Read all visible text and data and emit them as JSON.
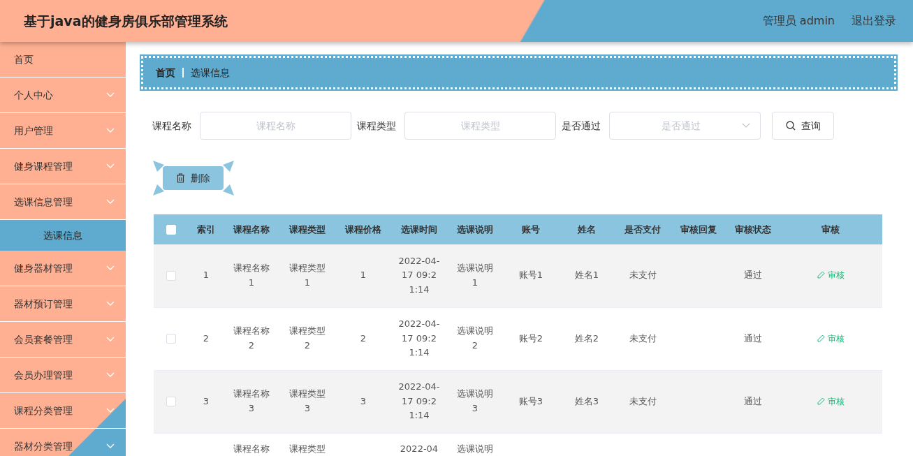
{
  "header": {
    "title": "基于java的健身房俱乐部管理系统",
    "user": "管理员 admin",
    "logout": "退出登录"
  },
  "sidebar": {
    "items": [
      {
        "label": "首页",
        "kind": "link"
      },
      {
        "label": "个人中心",
        "kind": "submenu"
      },
      {
        "label": "用户管理",
        "kind": "submenu"
      },
      {
        "label": "健身课程管理",
        "kind": "submenu"
      },
      {
        "label": "选课信息管理",
        "kind": "submenu",
        "children": [
          {
            "label": "选课信息",
            "selected": true
          }
        ]
      },
      {
        "label": "健身器材管理",
        "kind": "submenu"
      },
      {
        "label": "器材预订管理",
        "kind": "submenu"
      },
      {
        "label": "会员套餐管理",
        "kind": "submenu"
      },
      {
        "label": "会员办理管理",
        "kind": "submenu"
      },
      {
        "label": "课程分类管理",
        "kind": "submenu"
      },
      {
        "label": "器材分类管理",
        "kind": "submenu"
      }
    ]
  },
  "breadcrumb": [
    "首页",
    "选课信息"
  ],
  "filters": [
    {
      "label": "课程名称",
      "kind": "text",
      "placeholder": "课程名称"
    },
    {
      "label": "课程类型",
      "kind": "text",
      "placeholder": "课程类型"
    },
    {
      "label": "是否通过",
      "kind": "select",
      "placeholder": "是否通过"
    }
  ],
  "search_button": "查询",
  "delete_button": "删除",
  "table": {
    "columns": [
      "索引",
      "课程名称",
      "课程类型",
      "课程价格",
      "选课时间",
      "选课说明",
      "账号",
      "姓名",
      "是否支付",
      "审核回复",
      "审核状态",
      "审核"
    ],
    "header_checked": false,
    "rows": [
      {
        "checked": false,
        "cells": [
          "1",
          "课程名称1",
          "课程类型1",
          "1",
          "2022-04-17 09:21:14",
          "选课说明1",
          "账号1",
          "姓名1",
          "未支付",
          null,
          "通过"
        ],
        "action": "审核"
      },
      {
        "checked": false,
        "cells": [
          "2",
          "课程名称2",
          "课程类型2",
          "2",
          "2022-04-17 09:21:14",
          "选课说明2",
          "账号2",
          "姓名2",
          "未支付",
          null,
          "通过"
        ],
        "action": "审核"
      },
      {
        "checked": false,
        "cells": [
          "3",
          "课程名称3",
          "课程类型3",
          "3",
          "2022-04-17 09:21:14",
          "选课说明3",
          "账号3",
          "姓名3",
          "未支付",
          null,
          "通过"
        ],
        "action": "审核"
      },
      {
        "cells": [
          null,
          "课程名称",
          "课程类型",
          null,
          "2022-04",
          "选课说明",
          null,
          null,
          null,
          null,
          null
        ]
      }
    ]
  }
}
